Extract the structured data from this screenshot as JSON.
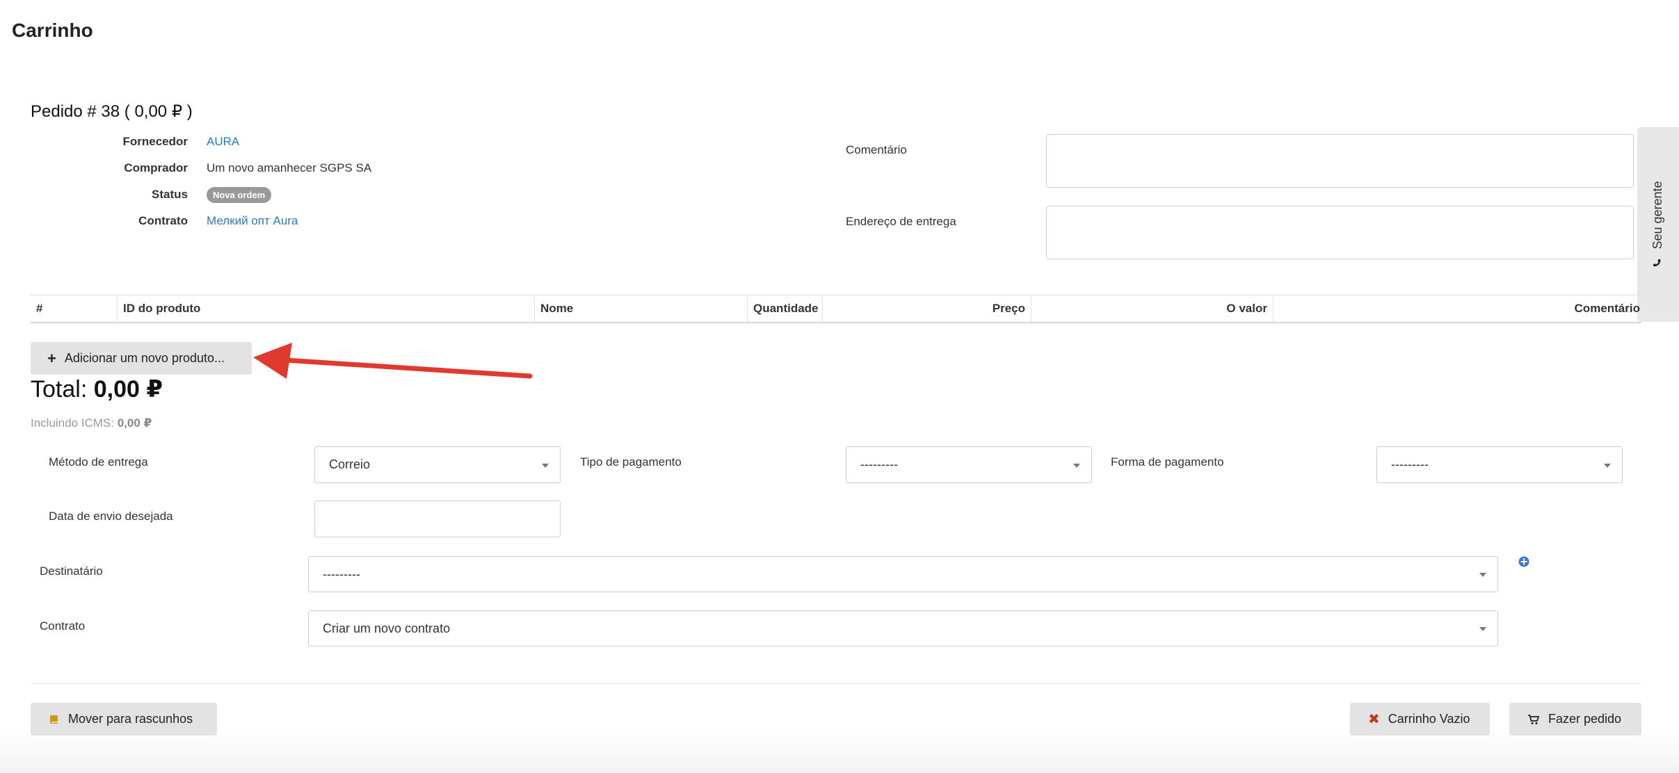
{
  "page": {
    "title": "Carrinho"
  },
  "order": {
    "title": "Pedido # 38 ( 0,00 ₽ )",
    "info": [
      {
        "label": "Fornecedor",
        "value": "AURA",
        "link": true
      },
      {
        "label": "Comprador",
        "value": "Um novo amanhecer SGPS SA",
        "link": false
      },
      {
        "label": "Status",
        "value": "Nova ordem",
        "badge": true
      },
      {
        "label": "Contrato",
        "value": "Мелкий опт Aura",
        "link": true
      }
    ],
    "comment_label": "Comentário",
    "comment_value": "",
    "address_label": "Endereço de entrega",
    "address_value": ""
  },
  "side_tab": {
    "label": "Seu gerente",
    "icon": "phone-icon"
  },
  "table": {
    "columns": [
      "#",
      "ID do produto",
      "Nome",
      "Quantidade",
      "Preço",
      "O valor",
      "Comentário"
    ],
    "rows": []
  },
  "add_product": {
    "label": "Adicionar um novo produto...",
    "icon": "plus-icon"
  },
  "totals": {
    "total_label": "Total:",
    "total_value": "0,00 ₽",
    "icms_label": "Incluindo ICMS:",
    "icms_value": "0,00 ₽"
  },
  "form": {
    "delivery_method_label": "Método de entrega",
    "delivery_method_value": "Correio",
    "payment_type_label": "Tipo de pagamento",
    "payment_type_value": "---------",
    "payment_form_label": "Forma de pagamento",
    "payment_form_value": "---------",
    "ship_date_label": "Data de envio desejada",
    "ship_date_value": "",
    "recipient_label": "Destinatário",
    "recipient_value": "---------",
    "contract_label": "Contrato",
    "contract_value": "Criar um novo contrato"
  },
  "actions": {
    "drafts_label": "Mover para rascunhos",
    "empty_label": "Carrinho Vazio",
    "order_label": "Fazer pedido"
  },
  "colors": {
    "link": "#2a7ac8",
    "badge": "#999999",
    "arrow": "#e03a2f",
    "button_bg": "#e3e3e3",
    "empty_icon": "#c0392b",
    "drafts_icon": "#c79a1a",
    "add_recipient_icon": "#3a7cd0"
  }
}
